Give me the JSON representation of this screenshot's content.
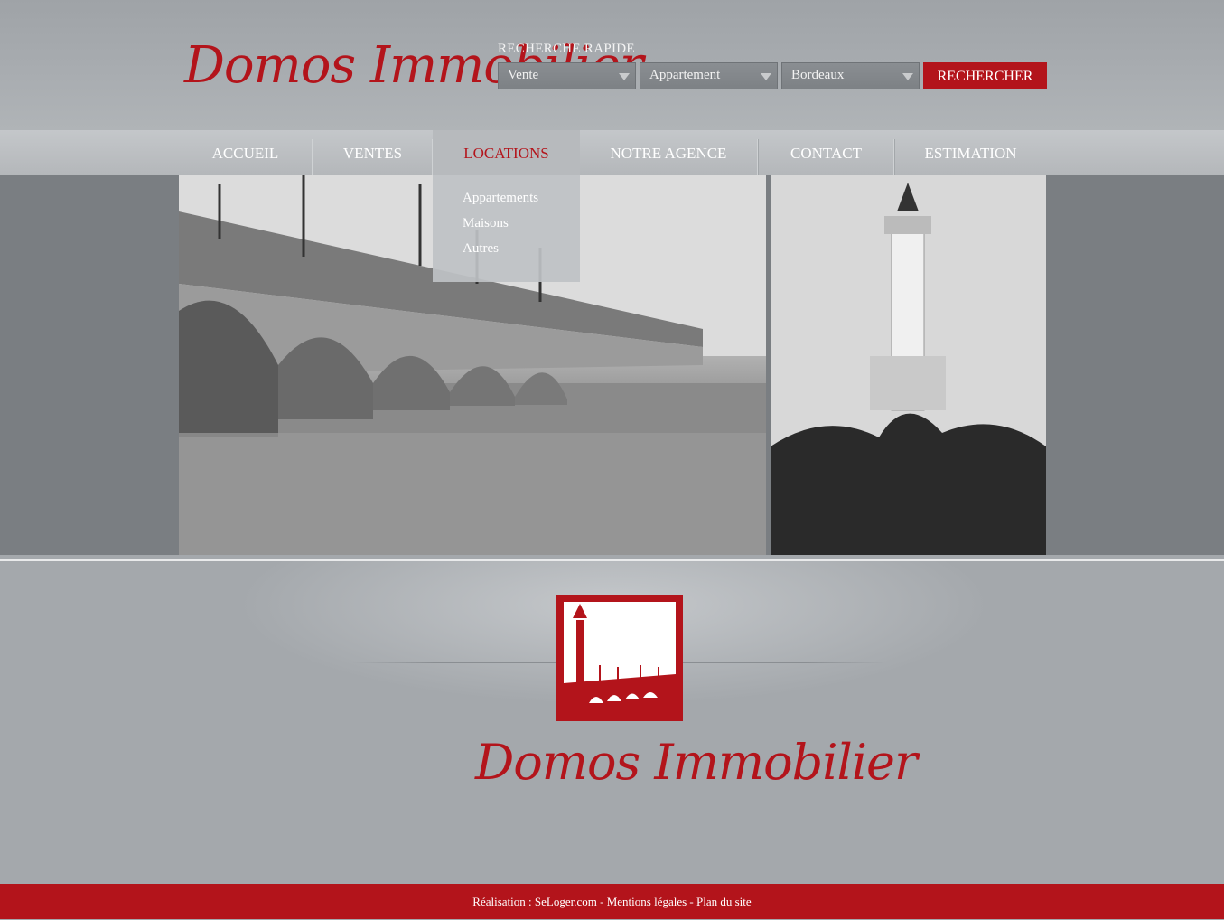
{
  "brand": {
    "name": "Domos Immobilier"
  },
  "quick_search": {
    "label": "RECHERCHE RAPIDE",
    "transaction": "Vente",
    "property_type": "Appartement",
    "city": "Bordeaux",
    "button": "RECHERCHER"
  },
  "nav": {
    "items": [
      "ACCUEIL",
      "VENTES",
      "LOCATIONS",
      "NOTRE AGENCE",
      "CONTACT",
      "ESTIMATION"
    ],
    "active": "LOCATIONS",
    "dropdown": [
      "Appartements",
      "Maisons",
      "Autres"
    ]
  },
  "footer": {
    "realisation": "Réalisation : SeLoger.com",
    "sep1": "-",
    "mentions": "Mentions légales",
    "sep2": "-",
    "plan": "Plan du site"
  },
  "colors": {
    "brand_red": "#b3141b",
    "background": "#a4a8ac"
  }
}
